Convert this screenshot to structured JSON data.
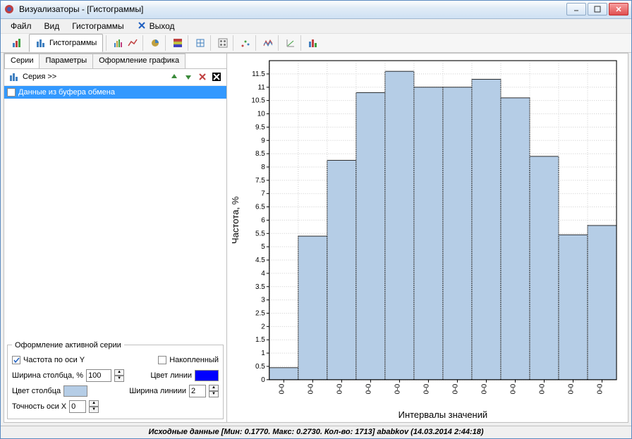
{
  "title": "Визуализаторы - [Гистограммы]",
  "menu": {
    "file": "Файл",
    "view": "Вид",
    "hist": "Гистограммы",
    "exit": "Выход"
  },
  "active_tab": "Гистограммы",
  "left": {
    "tabs": {
      "series": "Серии",
      "params": "Параметры",
      "design": "Оформление графика"
    },
    "series_btn": "Серия >>",
    "series_item": "Данные из буфера обмена",
    "group_title": "Оформление активной серии",
    "freq_y": "Частота по оси Y",
    "accum": "Накопленный",
    "bar_width": "Ширина столбца, %",
    "bar_width_val": "100",
    "bar_color": "Цвет столбца",
    "bar_color_val": "#b5cde6",
    "line_color": "Цвет линии",
    "line_color_val": "#0000ff",
    "line_width": "Ширина линиии",
    "line_width_val": "2",
    "x_prec": "Точность оси X",
    "x_prec_val": "0"
  },
  "status": "Исходные данные [Мин: 0.1770. Макс: 0.2730. Кол-во: 1713] ababkov (14.03.2014 2:44:18)",
  "chart_data": {
    "type": "bar",
    "title": "",
    "xlabel": "Интервалы значений",
    "ylabel": "Частота, %",
    "ylim": [
      0,
      12
    ],
    "yticks": [
      0,
      0.5,
      1,
      1.5,
      2,
      2.5,
      3,
      3.5,
      4,
      4.5,
      5,
      5.5,
      6,
      6.5,
      7,
      7.5,
      8,
      8.5,
      9,
      9.5,
      10,
      10.5,
      11,
      11.5
    ],
    "categories": [
      "0-0",
      "0-0",
      "0-0",
      "0-0",
      "0-0",
      "0-0",
      "0-0",
      "0-0",
      "0-0",
      "0-0",
      "0-0"
    ],
    "values": [
      0.45,
      5.4,
      8.25,
      10.8,
      11.6,
      11.0,
      11.0,
      11.3,
      10.6,
      8.4,
      5.45,
      5.8
    ],
    "bar_fill": "#b5cde6",
    "bar_stroke": "#000000"
  }
}
